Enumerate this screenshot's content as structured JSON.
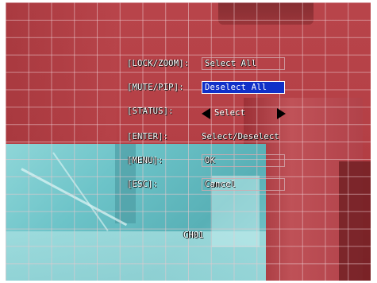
{
  "osd_menu": {
    "rows": [
      {
        "key": "[LOCK/ZOOM]:",
        "value": "Select All"
      },
      {
        "key": "[MUTE/PIP]:",
        "value": "Deselect All"
      },
      {
        "key": "[STATUS]:",
        "value": "Select"
      },
      {
        "key": "[ENTER]:",
        "value": "Select/Deselect"
      },
      {
        "key": "[MENU]:",
        "value": "OK"
      },
      {
        "key": "[ESC]:",
        "value": "Cancel"
      }
    ],
    "highlight_color": "#1030c8"
  },
  "channel_label": "CH01",
  "colors": {
    "main_feed": "#b13a3f",
    "pip_feed": "#6cc3c8",
    "grid_line": "#ebc8cd"
  },
  "icons": {
    "status_left": "arrow-left-icon",
    "status_right": "arrow-right-icon"
  }
}
